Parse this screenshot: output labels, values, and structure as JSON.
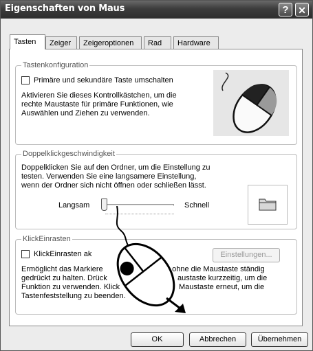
{
  "window": {
    "title": "Eigenschaften von Maus",
    "help_label": "?",
    "close_label": "✕"
  },
  "tabs": [
    {
      "label": "Tasten",
      "active": true
    },
    {
      "label": "Zeiger",
      "active": false
    },
    {
      "label": "Zeigeroptionen",
      "active": false
    },
    {
      "label": "Rad",
      "active": false
    },
    {
      "label": "Hardware",
      "active": false
    }
  ],
  "button_config": {
    "label": "Tastenkonfiguration",
    "checkbox_label": "Primäre und sekundäre Taste umschalten",
    "checked": false,
    "description_lines": [
      "Aktivieren Sie dieses Kontrollkästchen, um die",
      "rechte Maustaste für primäre Funktionen, wie",
      "Auswählen und Ziehen zu verwenden."
    ]
  },
  "double_click": {
    "label": "Doppelklickgeschwindigkeit",
    "description_lines": [
      "Doppelklicken Sie auf den Ordner, um die Einstellung zu",
      "testen. Verwenden Sie eine langsamere Einstellung,",
      "wenn der Ordner sich nicht öffnen oder schließen lässt."
    ],
    "slow_label": "Langsam",
    "fast_label": "Schnell",
    "slider_fraction": 0.0
  },
  "click_lock": {
    "label": "KlickEinrasten",
    "checkbox_label": "KlickEinrasten ak",
    "checked": false,
    "settings_button": "Einstellungen...",
    "description_lines": [
      "Ermöglicht das Markiere",
      ", ohne die Maustaste ständig",
      "gedrückt zu halten. Drück",
      "austaste kurzzeitig, um die",
      "Funktion zu verwenden. Klick",
      "Maustaste erneut, um die",
      "Tastenfeststellung zu beenden."
    ]
  },
  "footer": {
    "ok": "OK",
    "cancel": "Abbrechen",
    "apply": "Übernehmen"
  }
}
